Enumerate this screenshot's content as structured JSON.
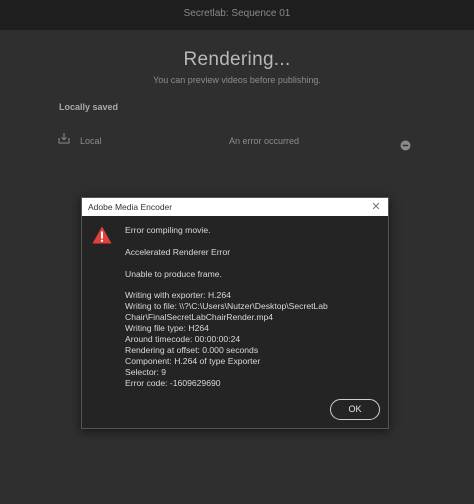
{
  "window": {
    "title": "Secretlab: Sequence 01"
  },
  "render": {
    "title": "Rendering...",
    "subtitle": "You can preview videos before publishing."
  },
  "saved_section": {
    "heading": "Locally saved",
    "item_label": "Local",
    "item_status": "An error occurred"
  },
  "dialog": {
    "title": "Adobe Media Encoder",
    "close_glyph": "✕",
    "lines": [
      "Error compiling movie.",
      "",
      "Accelerated Renderer Error",
      "",
      "Unable to produce frame.",
      "",
      "Writing with exporter: H.264",
      "Writing to file: \\\\?\\C:\\Users\\Nutzer\\Desktop\\SecretLab",
      "Chair\\FinalSecretLabChairRender.mp4",
      "Writing file type: H264",
      "Around timecode: 00:00:00:24",
      "Rendering at offset: 0.000 seconds",
      "Component: H.264 of type Exporter",
      "Selector: 9",
      "Error code: -1609629690"
    ],
    "ok_label": "OK"
  },
  "icons": {
    "warning": "warning-icon",
    "download": "download-icon",
    "stop": "stop-icon",
    "close": "close-icon"
  },
  "colors": {
    "warning": "#e0413d",
    "dialog_bg": "#242424",
    "page_bg": "#2f2f2f"
  }
}
